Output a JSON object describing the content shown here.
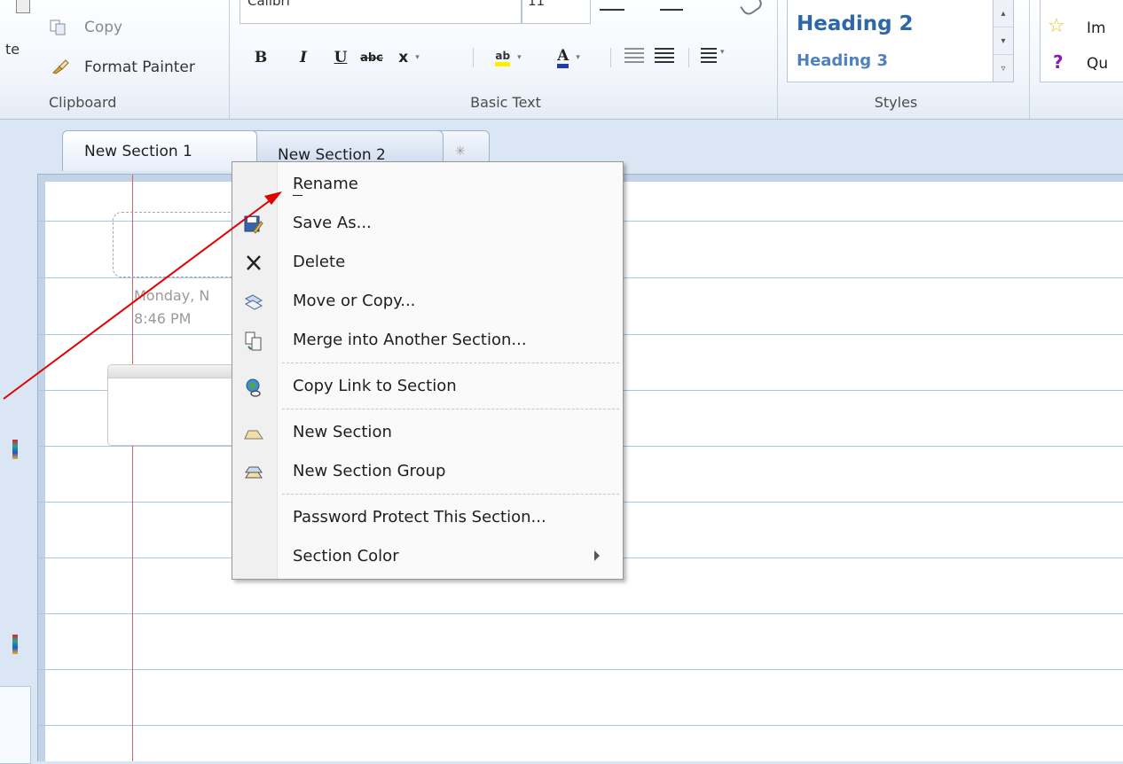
{
  "ribbon": {
    "clipboard": {
      "paste_partial": "te",
      "copy_label": "Copy",
      "format_painter_label": "Format Painter",
      "group_label": "Clipboard"
    },
    "basic_text": {
      "font_name": "Calibri",
      "font_size": "11",
      "bold": "B",
      "italic": "I",
      "underline": "U",
      "strikethrough": "abc",
      "subscript": "x",
      "highlight": "ab",
      "font_color": "A",
      "group_label": "Basic Text"
    },
    "styles": {
      "heading2": "Heading 2",
      "heading3": "Heading 3",
      "group_label": "Styles"
    },
    "tags": {
      "important_partial": "Im",
      "question_partial": "Qu"
    }
  },
  "section_tabs": [
    {
      "label": "New Section 1",
      "active": true
    },
    {
      "label": "New Section 2",
      "active": false
    },
    {
      "label": "",
      "active": false
    }
  ],
  "page": {
    "date_partial": "Monday, N",
    "time": "8:46 PM"
  },
  "context_menu": {
    "items": [
      {
        "label": "Rename",
        "icon": "none"
      },
      {
        "label": "Save As...",
        "icon": "save-as-icon"
      },
      {
        "label": "Delete",
        "icon": "delete-x-icon"
      },
      {
        "label": "Move or Copy...",
        "icon": "move-copy-icon"
      },
      {
        "label": "Merge into Another Section...",
        "icon": "merge-icon"
      },
      {
        "label": "Copy Link to Section",
        "icon": "link-globe-icon"
      },
      {
        "label": "New Section",
        "icon": "new-section-icon"
      },
      {
        "label": "New Section Group",
        "icon": "new-section-group-icon"
      },
      {
        "label": "Password Protect This Section...",
        "icon": "none"
      },
      {
        "label": "Section Color",
        "icon": "none",
        "submenu": true
      }
    ]
  },
  "colors": {
    "annotation_arrow": "#e00000",
    "margin_line": "#e55d5d",
    "rule_line": "#a8c6e6",
    "heading_blue": "#2d67a8"
  }
}
